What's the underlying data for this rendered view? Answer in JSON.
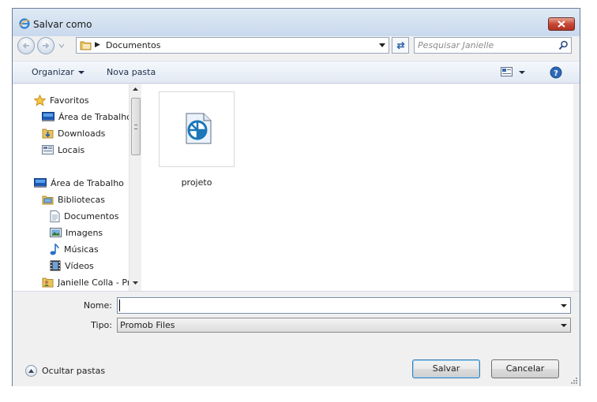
{
  "window": {
    "title": "Salvar como",
    "accent": "#c74836"
  },
  "navigation": {
    "address_path": "Documentos",
    "search_placeholder": "Pesquisar Janielle"
  },
  "toolbar": {
    "organize_label": "Organizar",
    "new_folder_label": "Nova pasta"
  },
  "nav_pane": {
    "items": [
      {
        "label": "Favoritos",
        "icon": "star-icon"
      },
      {
        "label": "Área de Trabalho",
        "icon": "desktop-icon"
      },
      {
        "label": "Downloads",
        "icon": "downloads-folder-icon"
      },
      {
        "label": "Locais",
        "icon": "recent-places-icon"
      },
      {
        "label": "Área de Trabalho",
        "icon": "desktop-icon"
      },
      {
        "label": "Bibliotecas",
        "icon": "libraries-icon"
      },
      {
        "label": "Documentos",
        "icon": "document-icon"
      },
      {
        "label": "Imagens",
        "icon": "pictures-icon"
      },
      {
        "label": "Músicas",
        "icon": "music-note-icon"
      },
      {
        "label": "Vídeos",
        "icon": "film-icon"
      },
      {
        "label": "Janielle Colla - Pr",
        "icon": "user-folder-icon"
      }
    ]
  },
  "files": [
    {
      "name": "projeto",
      "icon": "promob-file-icon"
    }
  ],
  "form": {
    "name_label": "Nome:",
    "name_value": "",
    "type_label": "Tipo:",
    "type_value": "Promob Files"
  },
  "footer": {
    "hide_folders_label": "Ocultar pastas",
    "save_label": "Salvar",
    "cancel_label": "Cancelar"
  }
}
